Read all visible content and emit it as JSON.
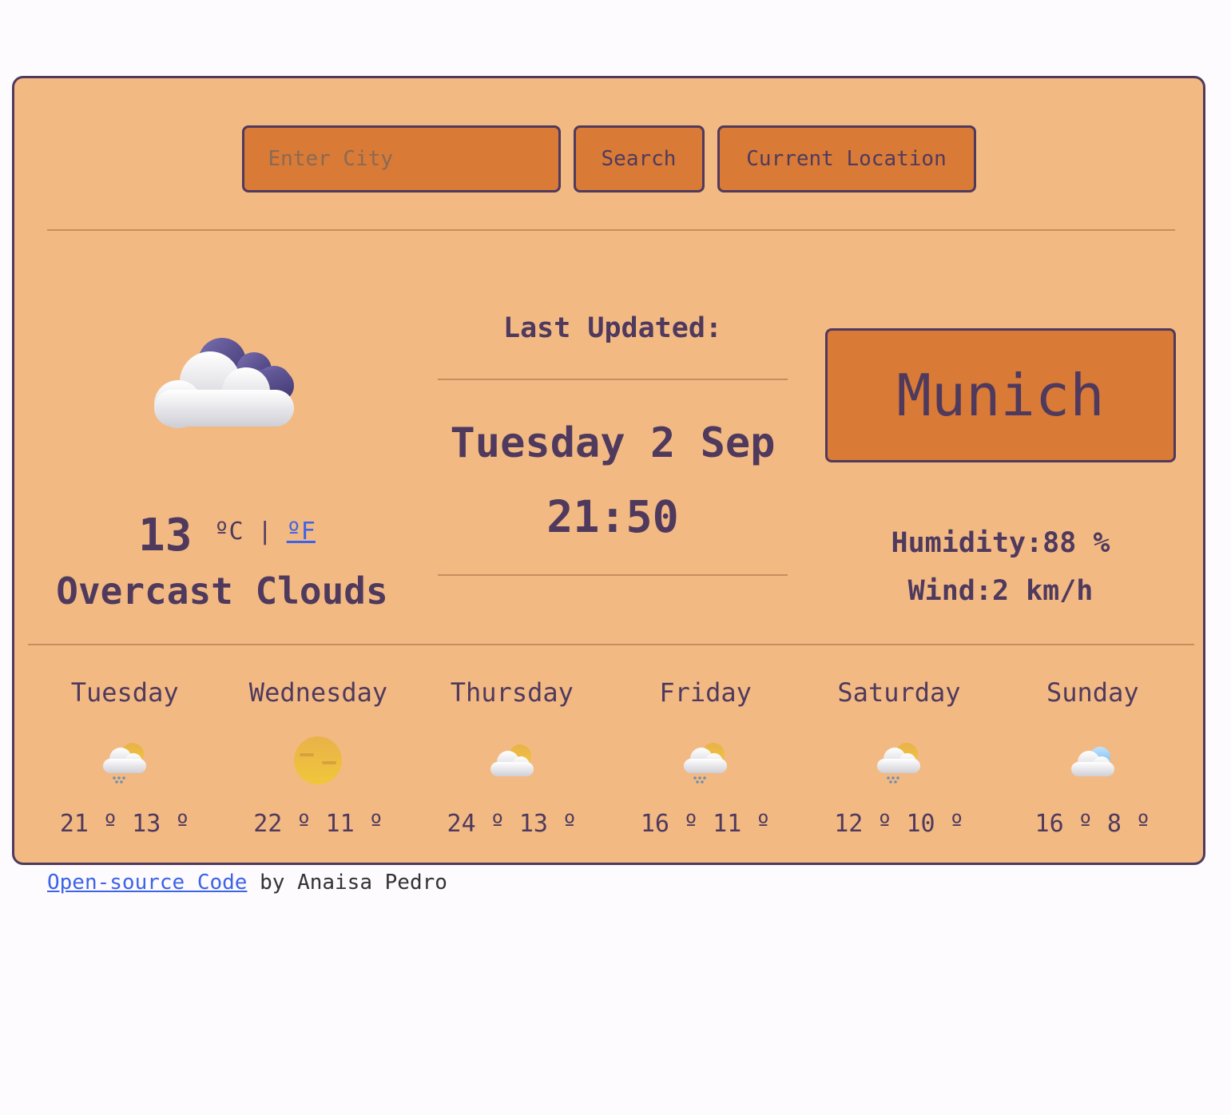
{
  "search": {
    "placeholder": "Enter City",
    "search_label": "Search",
    "location_label": "Current Location"
  },
  "current": {
    "icon": "overcast-clouds-icon",
    "temperature": "13",
    "unit_c": "ºC",
    "separator": "|",
    "unit_f": "ºF",
    "description": "Overcast Clouds"
  },
  "updated": {
    "label": "Last Updated:",
    "date": "Tuesday 2 Sep",
    "time": "21:50"
  },
  "city": "Munich",
  "stats": {
    "humidity": "Humidity:88 %",
    "wind": "Wind:2 km/h"
  },
  "forecast": [
    {
      "day": "Tuesday",
      "icon": "rain-sun-cloud-icon",
      "temps": "21 º 13 º"
    },
    {
      "day": "Wednesday",
      "icon": "sun-haze-icon",
      "temps": "22 º 11 º"
    },
    {
      "day": "Thursday",
      "icon": "partly-cloudy-icon",
      "temps": "24 º 13 º"
    },
    {
      "day": "Friday",
      "icon": "rain-sun-cloud-icon",
      "temps": "16 º 11 º"
    },
    {
      "day": "Saturday",
      "icon": "rain-sun-cloud-icon",
      "temps": "12 º 10 º"
    },
    {
      "day": "Sunday",
      "icon": "blue-cloud-icon",
      "temps": "16 º 8 º"
    }
  ],
  "footer": {
    "link": "Open-source Code",
    "text": " by Anaisa Pedro"
  },
  "colors": {
    "card": "#f3b982",
    "accent": "#d97a36",
    "text": "#4f3a5e",
    "link": "#3d63e8"
  }
}
